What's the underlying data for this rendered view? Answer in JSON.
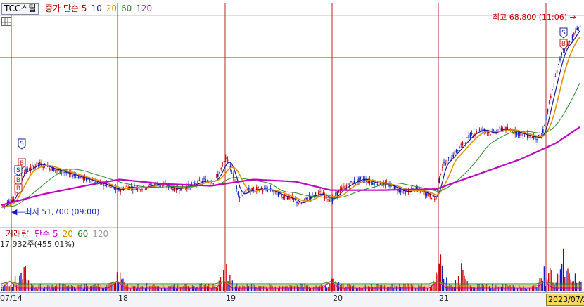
{
  "header": {
    "stock_name": "TCC스틸",
    "series": [
      {
        "label": "종가 단순 5",
        "color": "#c00000"
      },
      {
        "label": "10",
        "color": "#1a1a8c"
      },
      {
        "label": "20",
        "color": "#e09000"
      },
      {
        "label": "60",
        "color": "#2a8a2a"
      },
      {
        "label": "120",
        "color": "#c000c0"
      }
    ]
  },
  "annotations": {
    "high": "최고 68,800 (11:06)",
    "low": "최저 51,700 (09:00)",
    "markers": [
      "S",
      "B",
      "S",
      "B",
      "B",
      "S",
      "B"
    ]
  },
  "volume_panel": {
    "legend_prefix": "거래량",
    "series": [
      {
        "label": "단순 5",
        "color": "#c000c0"
      },
      {
        "label": "20",
        "color": "#e09000"
      },
      {
        "label": "60",
        "color": "#2a8a2a"
      },
      {
        "label": "120",
        "color": "#999999"
      }
    ],
    "value_text": "17,932주(455.01%)"
  },
  "x_axis": {
    "labels": [
      "07/14",
      "18",
      "19",
      "20",
      "21"
    ],
    "current_date": "2023/07/2"
  },
  "colors": {
    "up": "#d00000",
    "down": "#1020c0",
    "grid_red": "#c02020",
    "ma5": "#c00000",
    "ma10": "#1a1a8c",
    "ma20": "#e09000",
    "ma60": "#2a8a2a",
    "ma120": "#c000c0"
  },
  "chart_data": {
    "type": "line",
    "title": "TCC스틸",
    "x": [
      "07/14",
      "18",
      "19",
      "20",
      "21"
    ],
    "price_high": 68800,
    "price_low": 51700,
    "series": [
      {
        "name": "종가 단순 5",
        "values": [
          54500,
          53600,
          54000,
          52900,
          60900
        ]
      },
      {
        "name": "10",
        "values": [
          54300,
          53800,
          53900,
          53100,
          60000
        ]
      },
      {
        "name": "20",
        "values": [
          54100,
          53900,
          53800,
          53300,
          59100
        ]
      },
      {
        "name": "60",
        "values": [
          53800,
          54000,
          53700,
          53500,
          57600
        ]
      },
      {
        "name": "120",
        "values": [
          52500,
          54300,
          54300,
          53300,
          56000
        ]
      }
    ],
    "volume_last": "17,932주(455.01%)"
  }
}
